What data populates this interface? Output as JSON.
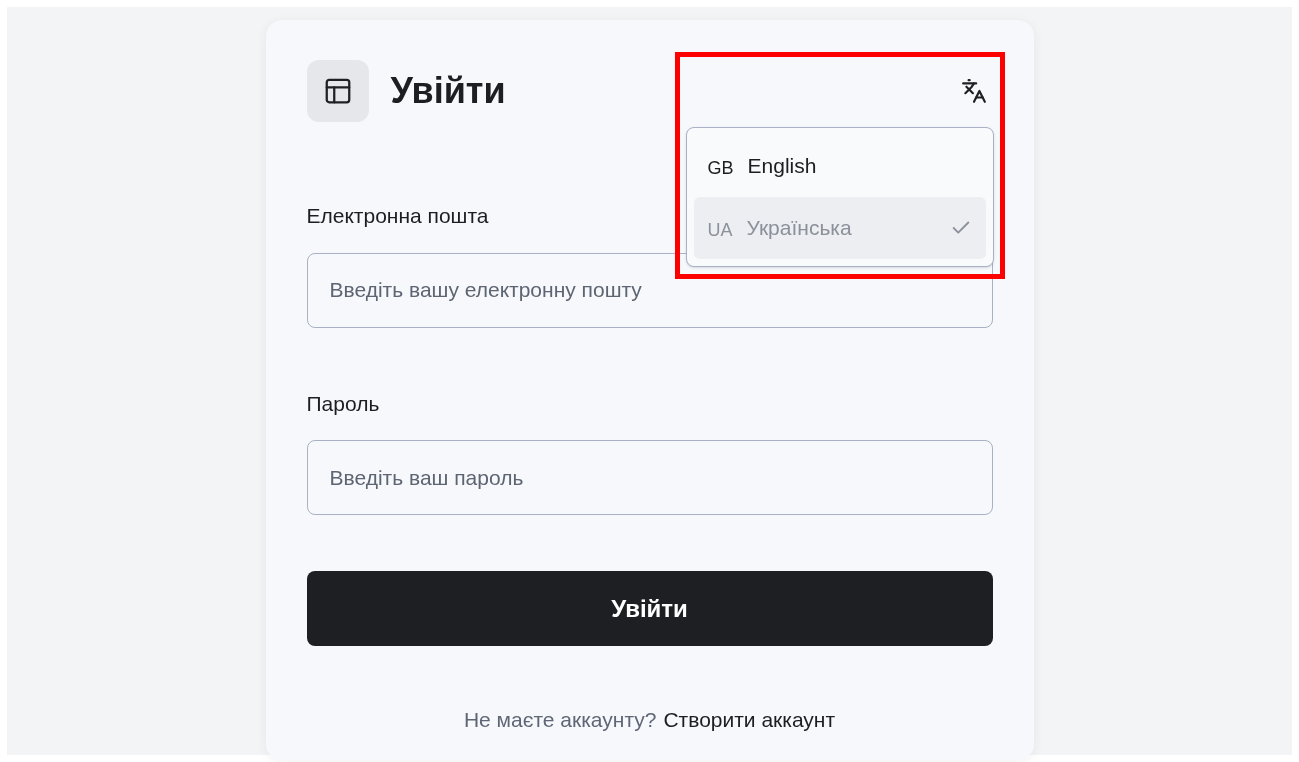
{
  "header": {
    "title": "Увійти"
  },
  "language_menu": {
    "open": true,
    "options": [
      {
        "code": "GB",
        "label": "English",
        "selected": false
      },
      {
        "code": "UA",
        "label": "Українська",
        "selected": true
      }
    ]
  },
  "fields": [
    {
      "label": "Електронна пошта",
      "placeholder": "Введіть вашу електронну пошту"
    },
    {
      "label": "Пароль",
      "placeholder": "Введіть ваш пароль"
    }
  ],
  "submit_button": "Увійти",
  "footer": {
    "text": "Не маєте аккаунту?",
    "link": "Створити аккаунт"
  }
}
